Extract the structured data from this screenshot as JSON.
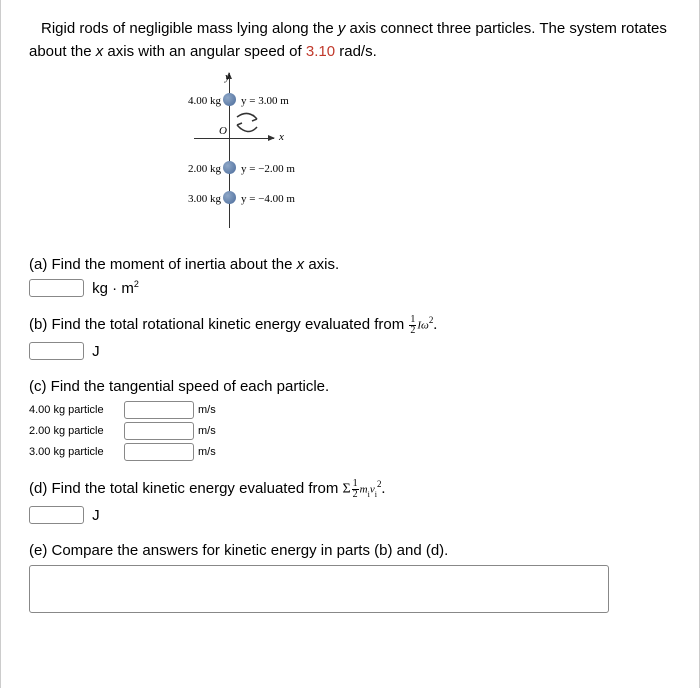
{
  "intro": {
    "text1": "Rigid rods of negligible mass lying along the ",
    "yvar": "y",
    "text2": " axis connect three particles. The system rotates about the ",
    "xvar": "x",
    "text3": " axis with an angular speed of ",
    "omega": "3.10",
    "text4": " rad/s."
  },
  "diagram": {
    "ylabel": "y",
    "xlabel": "x",
    "origin": "O",
    "particles": [
      {
        "mass": "4.00 kg",
        "ypos": "y = 3.00 m"
      },
      {
        "mass": "2.00 kg",
        "ypos": "y = −2.00 m"
      },
      {
        "mass": "3.00 kg",
        "ypos": "y = −4.00 m"
      }
    ]
  },
  "parts": {
    "a": {
      "q": "(a) Find the moment of inertia about the ",
      "var": "x",
      "q2": " axis.",
      "unit": "kg · m",
      "sup": "2"
    },
    "b": {
      "q": "(b) Find the total rotational kinetic energy evaluated from ",
      "frac_num": "1",
      "frac_den": "2",
      "var1": "I",
      "var2": "ω",
      "sup": "2",
      "end": ".",
      "unit": "J"
    },
    "c": {
      "q": "(c) Find the tangential speed of each particle.",
      "rows": [
        {
          "label": "4.00 kg particle",
          "unit": "m/s"
        },
        {
          "label": "2.00 kg particle",
          "unit": "m/s"
        },
        {
          "label": "3.00 kg particle",
          "unit": "m/s"
        }
      ]
    },
    "d": {
      "q": "(d) Find the total kinetic energy evaluated from ",
      "sigma": "Σ",
      "frac_num": "1",
      "frac_den": "2",
      "var1": "m",
      "sub1": "i",
      "var2": "v",
      "sub2": "i",
      "sup": "2",
      "end": ".",
      "unit": "J"
    },
    "e": {
      "q": "(e) Compare the answers for kinetic energy in parts (b) and (d)."
    }
  }
}
